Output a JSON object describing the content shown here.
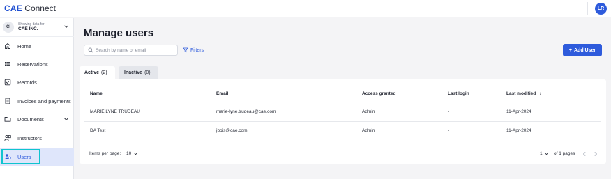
{
  "app": {
    "brand": "CAE",
    "product": "Connect",
    "user_initials": "LR"
  },
  "org": {
    "initials": "CI",
    "caption": "Showing data for",
    "name": "CAE INC."
  },
  "sidebar": {
    "items": [
      {
        "label": "Home",
        "icon": "home-icon"
      },
      {
        "label": "Reservations",
        "icon": "list-icon"
      },
      {
        "label": "Records",
        "icon": "checkbox-icon"
      },
      {
        "label": "Invoices and payments",
        "icon": "document-icon"
      },
      {
        "label": "Documents",
        "icon": "folder-icon",
        "has_caret": true
      },
      {
        "label": "Instructors",
        "icon": "instructors-icon"
      },
      {
        "label": "Users",
        "icon": "users-icon",
        "active": true
      }
    ]
  },
  "main": {
    "title": "Manage users",
    "search_placeholder": "Search by name or email",
    "filters_label": "Filters",
    "add_user_label": "Add User",
    "tabs": [
      {
        "label": "Active",
        "count": "(2)",
        "active": true
      },
      {
        "label": "Inactive",
        "count": "(0)",
        "active": false
      }
    ],
    "table": {
      "columns": [
        "Name",
        "Email",
        "Access granted",
        "Last login",
        "Last modified"
      ],
      "sort_indicator": "↓",
      "rows": [
        {
          "name": "MARIE LYNE TRUDEAU",
          "email": "marie-lyne.trudeau@cae.com",
          "access": "Admin",
          "last_login": "-",
          "last_modified": "11-Apr-2024"
        },
        {
          "name": "DA Test",
          "email": "jbois@cae.com",
          "access": "Admin",
          "last_login": "-",
          "last_modified": "11-Apr-2024"
        }
      ]
    },
    "pagination": {
      "items_per_page_label": "Items per page:",
      "items_per_page": "10",
      "current_page": "1",
      "of_pages": "of 1 pages"
    }
  },
  "colors": {
    "accent": "#2e5bdc",
    "active_nav_bg": "#dfe6fb",
    "highlight_outline": "#10c4cf"
  }
}
